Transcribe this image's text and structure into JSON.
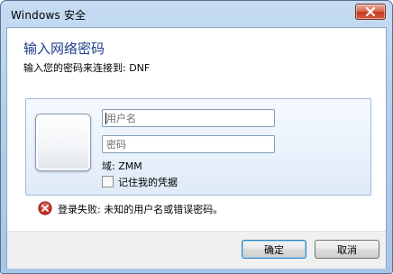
{
  "window": {
    "title": "Windows 安全"
  },
  "dialog": {
    "heading": "输入网络密码",
    "subline": "输入您的密码来连接到: DNF"
  },
  "credentials": {
    "username_placeholder": "用户名",
    "password_placeholder": "密码",
    "domain_label": "域: ZMM",
    "remember_label": "记住我的凭据",
    "remember_checked": false
  },
  "error": {
    "message": "登录失败: 未知的用户名或错误密码。"
  },
  "buttons": {
    "ok": "确定",
    "cancel": "取消"
  },
  "colors": {
    "heading": "#1e3d8a",
    "error_icon": "#c8302a",
    "close_button": "#c4391f"
  }
}
